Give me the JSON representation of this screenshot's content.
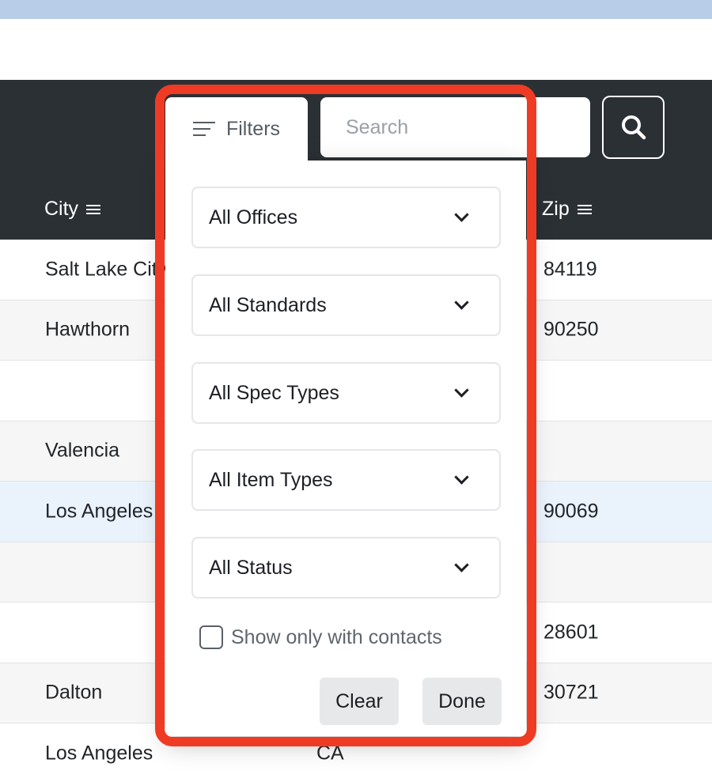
{
  "table": {
    "headers": {
      "city": "City",
      "zip": "Zip"
    },
    "rows": [
      {
        "city": "Salt Lake City",
        "state": "",
        "zip": "84119",
        "style": "normal"
      },
      {
        "city": "Hawthorn",
        "state": "",
        "zip": "90250",
        "style": "alt"
      },
      {
        "city": "",
        "state": "",
        "zip": "",
        "style": "normal"
      },
      {
        "city": "Valencia",
        "state": "",
        "zip": "",
        "style": "alt"
      },
      {
        "city": "Los Angeles",
        "state": "",
        "zip": "90069",
        "style": "sel"
      },
      {
        "city": "",
        "state": "",
        "zip": "",
        "style": "alt"
      },
      {
        "city": "",
        "state": "",
        "zip": "28601",
        "style": "normal"
      },
      {
        "city": "Dalton",
        "state": "",
        "zip": "30721",
        "style": "alt"
      },
      {
        "city": "Los Angeles",
        "state": "CA",
        "zip": "",
        "style": "normal"
      }
    ]
  },
  "toolbar": {
    "filters_label": "Filters",
    "search_placeholder": "Search"
  },
  "filters": {
    "offices": "All Offices",
    "standards": "All Standards",
    "spec_types": "All Spec Types",
    "item_types": "All Item Types",
    "status": "All Status",
    "contacts_checkbox": "Show only with contacts",
    "clear_label": "Clear",
    "done_label": "Done"
  },
  "colors": {
    "header_bg": "#2b3035",
    "highlight": "#ef3b24",
    "top_strip": "#b8cde8",
    "selected_row": "#eaf2fc"
  }
}
